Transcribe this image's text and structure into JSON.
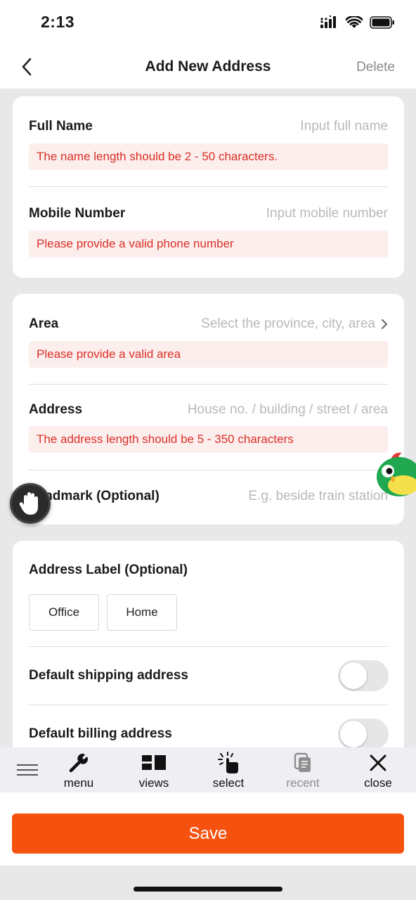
{
  "status_bar": {
    "time": "2:13"
  },
  "nav": {
    "title": "Add New Address",
    "delete_label": "Delete"
  },
  "contact": {
    "full_name_label": "Full Name",
    "full_name_placeholder": "Input full name",
    "full_name_error": "The name length should be 2 - 50 characters.",
    "mobile_label": "Mobile Number",
    "mobile_placeholder": "Input mobile number",
    "mobile_error": "Please provide a valid phone number"
  },
  "location": {
    "area_label": "Area",
    "area_placeholder": "Select the province, city, area",
    "area_error": "Please provide a valid area",
    "address_label": "Address",
    "address_placeholder": "House no. / building / street / area",
    "address_error": "The address length should be 5 - 350 characters",
    "landmark_label": "Landmark (Optional)",
    "landmark_placeholder": "E.g. beside train station"
  },
  "options": {
    "label_title": "Address Label (Optional)",
    "chips": [
      "Office",
      "Home"
    ],
    "default_shipping_label": "Default shipping address",
    "default_shipping_on": false,
    "default_billing_label": "Default billing address",
    "default_billing_on": false
  },
  "toolbar": {
    "menu_label": "menu",
    "views_label": "views",
    "select_label": "select",
    "recent_label": "recent",
    "close_label": "close"
  },
  "save_label": "Save",
  "colors": {
    "accent": "#f6520f",
    "error_text": "#d93025",
    "error_bg": "#fdeeee",
    "page_bg": "#e8e8e8"
  },
  "icons": [
    "back-chevron-icon",
    "signal-icon",
    "wifi-icon",
    "battery-icon",
    "chevron-right-icon",
    "hamburger-icon",
    "wrench-icon",
    "views-icon",
    "select-pointer-icon",
    "recent-icon",
    "close-icon",
    "hand-icon",
    "bird-mascot-icon"
  ]
}
